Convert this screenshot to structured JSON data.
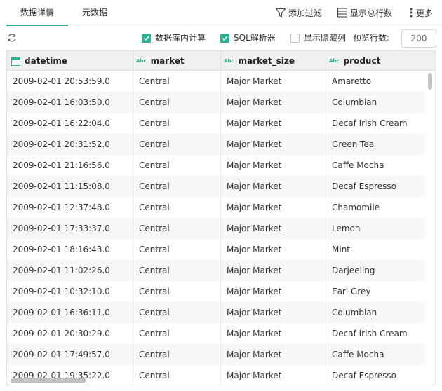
{
  "tabs": [
    {
      "label": "数据详情",
      "active": true
    },
    {
      "label": "元数据",
      "active": false
    }
  ],
  "toolbar": {
    "filter_label": "添加过滤",
    "rowcount_label": "显示总行数",
    "more_label": "更多"
  },
  "options": {
    "db_compute_label": "数据库内计算",
    "db_compute_checked": true,
    "sql_parser_label": "SQL解析器",
    "sql_parser_checked": true,
    "show_hidden_label": "显示隐藏列",
    "show_hidden_checked": false,
    "preview_rows_label": "预览行数:",
    "preview_rows_value": "200"
  },
  "colors": {
    "accent": "#2bb18f"
  },
  "columns": [
    {
      "name": "datetime",
      "type_icon": "calendar-icon"
    },
    {
      "name": "market",
      "type_icon": "abc-type-icon",
      "type_text": "Abc"
    },
    {
      "name": "market_size",
      "type_icon": "abc-type-icon",
      "type_text": "Abc"
    },
    {
      "name": "product",
      "type_icon": "abc-type-icon",
      "type_text": "Abc"
    }
  ],
  "rows": [
    [
      "2009-02-01 20:53:59.0",
      "Central",
      "Major Market",
      "Amaretto"
    ],
    [
      "2009-02-01 16:03:50.0",
      "Central",
      "Major Market",
      "Columbian"
    ],
    [
      "2009-02-01 16:22:04.0",
      "Central",
      "Major Market",
      "Decaf Irish Cream"
    ],
    [
      "2009-02-01 20:31:52.0",
      "Central",
      "Major Market",
      "Green Tea"
    ],
    [
      "2009-02-01 21:16:56.0",
      "Central",
      "Major Market",
      "Caffe Mocha"
    ],
    [
      "2009-02-01 11:15:08.0",
      "Central",
      "Major Market",
      "Decaf Espresso"
    ],
    [
      "2009-02-01 12:37:48.0",
      "Central",
      "Major Market",
      "Chamomile"
    ],
    [
      "2009-02-01 17:33:37.0",
      "Central",
      "Major Market",
      "Lemon"
    ],
    [
      "2009-02-01 18:16:43.0",
      "Central",
      "Major Market",
      "Mint"
    ],
    [
      "2009-02-01 11:02:26.0",
      "Central",
      "Major Market",
      "Darjeeling"
    ],
    [
      "2009-02-01 10:32:10.0",
      "Central",
      "Major Market",
      "Earl Grey"
    ],
    [
      "2009-02-01 16:36:11.0",
      "Central",
      "Major Market",
      "Columbian"
    ],
    [
      "2009-02-01 20:30:29.0",
      "Central",
      "Major Market",
      "Decaf Irish Cream"
    ],
    [
      "2009-02-01 17:49:57.0",
      "Central",
      "Major Market",
      "Caffe Mocha"
    ],
    [
      "2009-02-01 19:35:22.0",
      "Central",
      "Major Market",
      "Decaf Espresso"
    ]
  ]
}
